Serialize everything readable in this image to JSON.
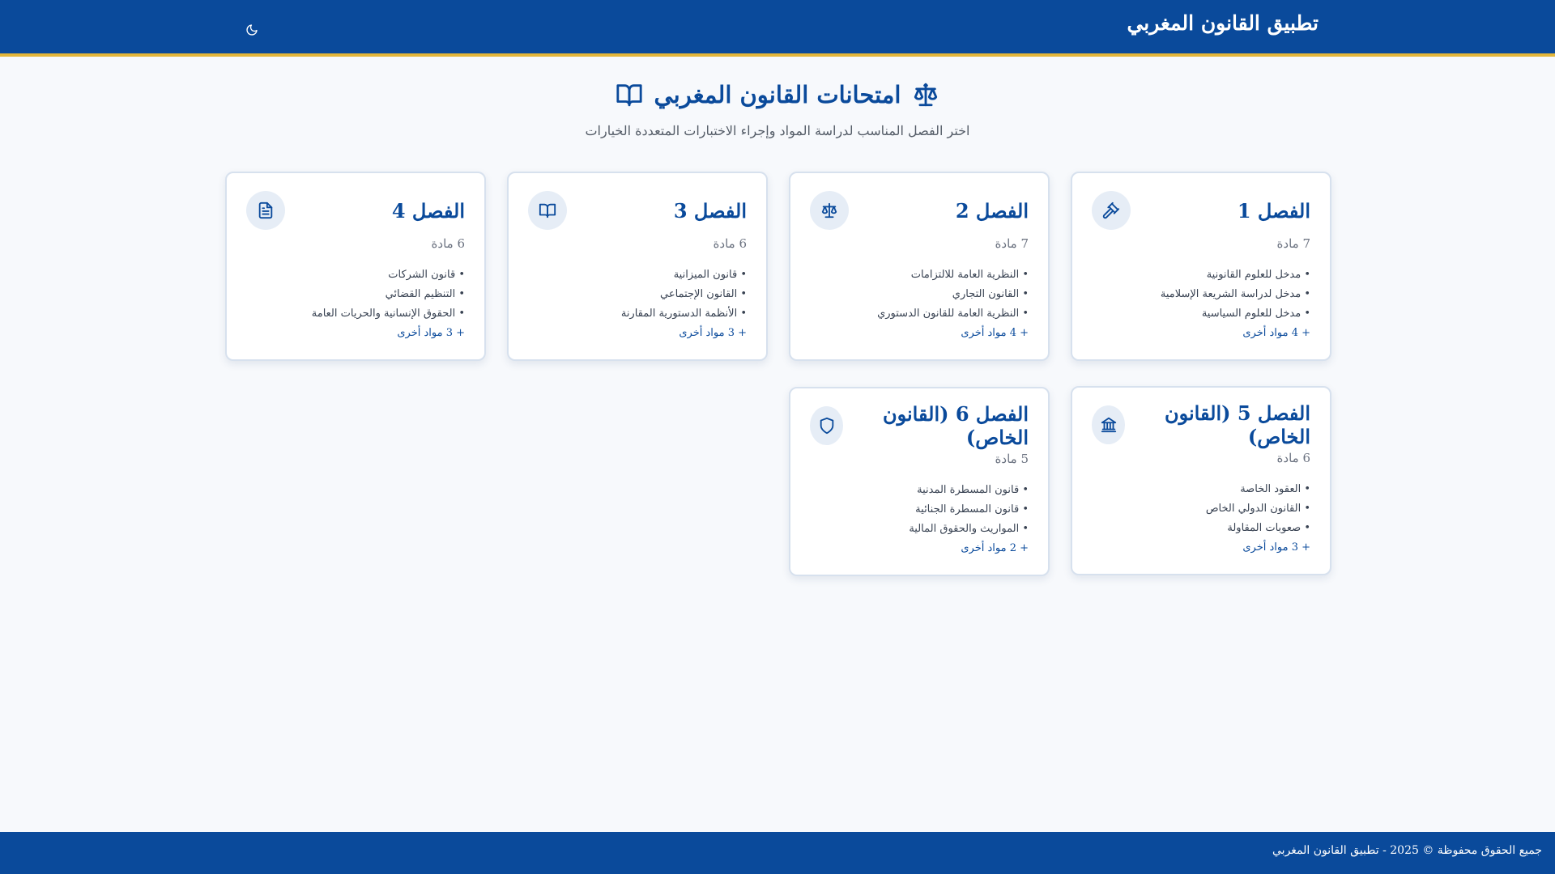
{
  "header": {
    "app_title": "تطبيق القانون المغربي",
    "theme_icon": "moon-icon"
  },
  "page": {
    "title": "امتحانات القانون المغربي",
    "title_icons": [
      "scale-icon",
      "open-book-icon"
    ],
    "subtitle": "اختر الفصل المناسب لدراسة المواد وإجراء الاختبارات المتعددة الخيارات"
  },
  "semesters": [
    {
      "title": "الفصل 1",
      "icon": "gavel-icon",
      "count": "7 مادة",
      "subjects": [
        "• مدخل للعلوم القانونية",
        "• مدخل لدراسة الشريعة الإسلامية",
        "• مدخل للعلوم السياسية"
      ],
      "more": "+ 4 مواد أخرى"
    },
    {
      "title": "الفصل 2",
      "icon": "scale-icon",
      "count": "7 مادة",
      "subjects": [
        "• النظرية العامة للالتزامات",
        "• القانون التجاري",
        "• النظرية العامة للقانون الدستوري"
      ],
      "more": "+ 4 مواد أخرى"
    },
    {
      "title": "الفصل 3",
      "icon": "open-book-icon",
      "count": "6 مادة",
      "subjects": [
        "• قانون الميزانية",
        "• القانون الإجتماعي",
        "• الأنظمة الدستورية المقارنة"
      ],
      "more": "+ 3 مواد أخرى"
    },
    {
      "title": "الفصل 4",
      "icon": "document-icon",
      "count": "6 مادة",
      "subjects": [
        "• قانون الشركات",
        "• التنظيم القضائي",
        "• الحقوق الإنسانية والحريات العامة"
      ],
      "more": "+ 3 مواد أخرى"
    },
    {
      "title": "الفصل 5 (القانون الخاص)",
      "icon": "bank-icon",
      "count": "6 مادة",
      "subjects": [
        "• العقود الخاصة",
        "• القانون الدولي الخاص",
        "• صعوبات المقاولة"
      ],
      "more": "+ 3 مواد أخرى"
    },
    {
      "title": "الفصل 6 (القانون الخاص)",
      "icon": "shield-icon",
      "count": "5 مادة",
      "subjects": [
        "• قانون المسطرة المدنية",
        "• قانون المسطرة الجنائية",
        "• المواريث والحقوق المالية"
      ],
      "more": "+ 2 مواد أخرى"
    }
  ],
  "footer": {
    "text": "جميع الحقوق محفوظة © 2025 - تطبيق القانون المغربي"
  },
  "colors": {
    "primary": "#0a4a9b",
    "accent": "#e3b63a",
    "background": "#f7f9fc"
  }
}
